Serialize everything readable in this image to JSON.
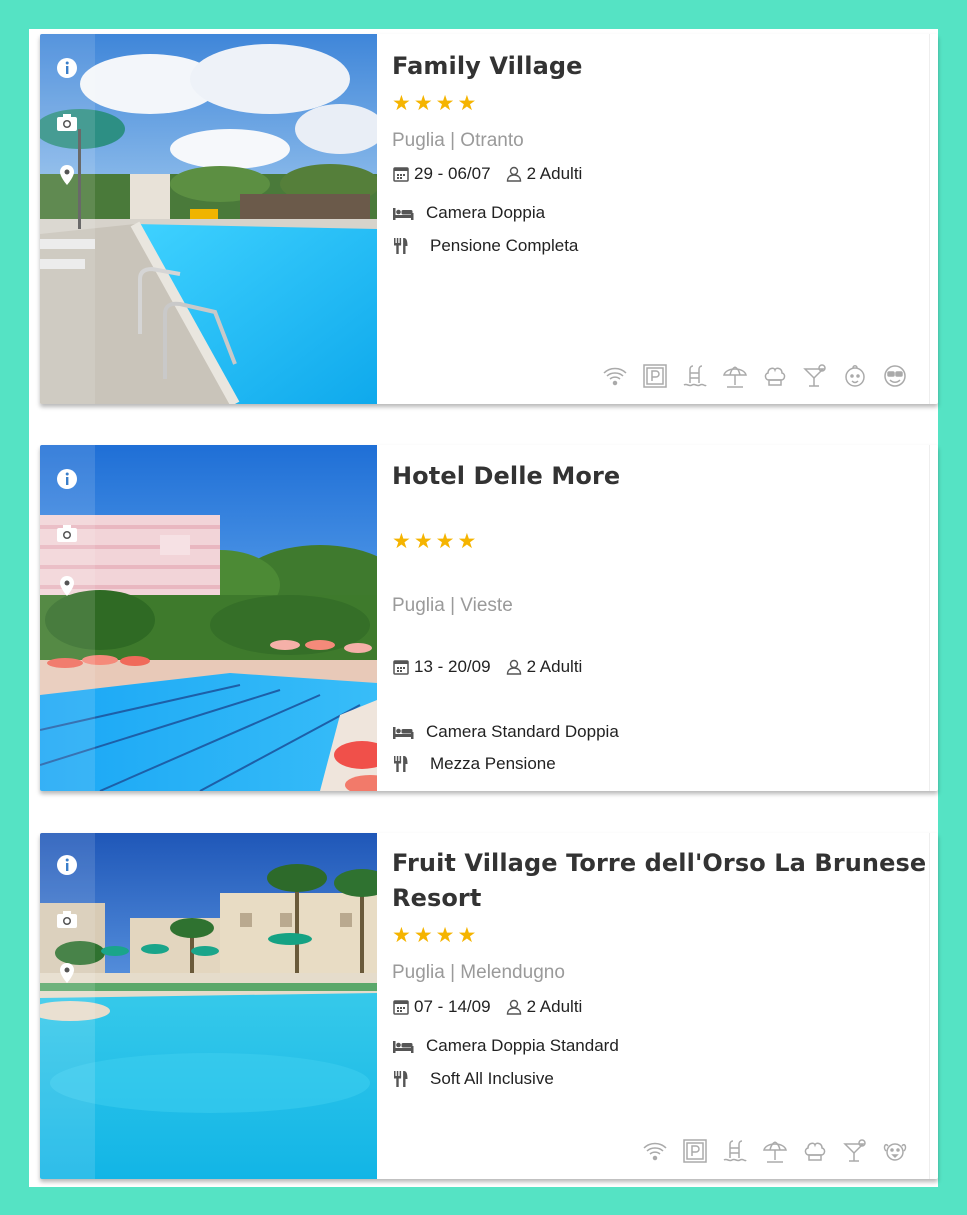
{
  "results": [
    {
      "name": "Family Village",
      "stars": "★★★★",
      "location": "Puglia | Otranto",
      "dates": "29 - 06/07",
      "guests": "2 Adulti",
      "room": "Camera Doppia",
      "board": "Pensione Completa",
      "amenities": [
        "wifi-icon",
        "parking-icon",
        "pool-icon",
        "beach-umbrella-icon",
        "chef-hat-icon",
        "cocktail-icon",
        "baby-icon",
        "smiley-icon"
      ]
    },
    {
      "name": "Hotel Delle More",
      "stars": "★★★★",
      "location": "Puglia | Vieste",
      "dates": "13 - 20/09",
      "guests": "2 Adulti",
      "room": "Camera Standard Doppia",
      "board": "Mezza Pensione",
      "amenities": []
    },
    {
      "name": "Fruit Village Torre dell'Orso La Brunese",
      "name_line2": "Resort",
      "stars": "★★★★",
      "location": "Puglia | Melendugno",
      "dates": "07 - 14/09",
      "guests": "2 Adulti",
      "room": "Camera Doppia Standard",
      "board": "Soft All Inclusive",
      "amenities": [
        "wifi-icon",
        "parking-icon",
        "pool-icon",
        "beach-umbrella-icon",
        "chef-hat-icon",
        "cocktail-icon",
        "pet-icon"
      ]
    }
  ],
  "colors": {
    "background": "#55e3c4",
    "star": "#f5b400",
    "location": "#9a9a9a"
  }
}
